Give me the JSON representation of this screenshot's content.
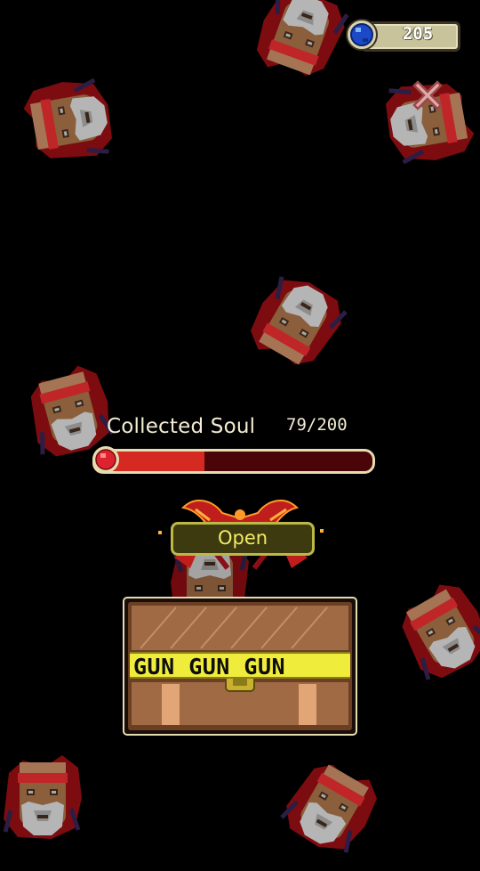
{
  "currency": {
    "value": "205",
    "icon": "blue-gem-icon"
  },
  "close": {
    "icon": "close-icon"
  },
  "soul": {
    "label": "Collected Soul",
    "count": "79/200",
    "current": 79,
    "max": 200
  },
  "open_button": {
    "label": "Open"
  },
  "chest": {
    "band_text": "GUN GUN GUN"
  },
  "colors": {
    "bar_fill": "#d42a22",
    "bar_bg": "#4a0508",
    "chest_band": "#f0ec3c",
    "button_text": "#f1ea6a"
  }
}
